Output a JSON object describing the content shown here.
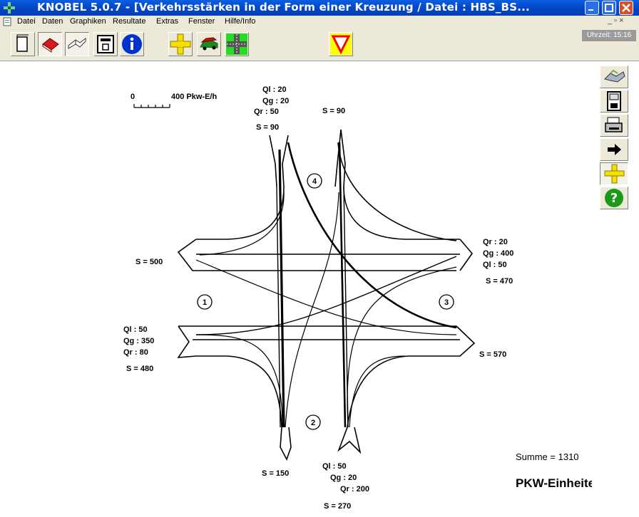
{
  "window": {
    "title": "KNOBEL 5.0.7 - [Verkehrsstärken in der Form einer Kreuzung / Datei :  HBS_BS..."
  },
  "menu": {
    "items": [
      "Datei",
      "Daten",
      "Graphiken",
      "Resultate",
      "Extras",
      "Fenster",
      "Hilfe/Info"
    ],
    "mdi_controls": "_ ▫ ×"
  },
  "status": {
    "clock": "Uhrzeit: 15:16"
  },
  "toolbar": {
    "icons": [
      "new-document-icon",
      "book-icon",
      "open-book-icon",
      "calculator-icon",
      "info-icon",
      "crossroad-icon",
      "cars-icon",
      "green-cross-icon",
      "yield-sign-icon"
    ]
  },
  "sidebar": {
    "icons": [
      "handshake-icon",
      "floppy-disk-icon",
      "printer-icon",
      "arrow-right-icon",
      "ruler-cross-icon",
      "help-icon"
    ]
  },
  "scale": {
    "zero": "0",
    "text": "400 Pkw-E/h"
  },
  "arms": {
    "north": {
      "number": "4",
      "ql": "Ql  : 20",
      "qg": "Qg : 20",
      "qr": "Qr : 50",
      "s_in": "S =  90",
      "s_out": "S =  90"
    },
    "west": {
      "number": "1",
      "ql": "Ql : 50",
      "qg": "Qg : 350",
      "qr": "Qr : 80",
      "s_in": "S =  480",
      "s_out": "S =  500"
    },
    "east": {
      "number": "3",
      "qr": "Qr : 20",
      "qg": "Qg : 400",
      "ql": "Ql  : 50",
      "s_in": "S =  470",
      "s_out": "S =  570"
    },
    "south": {
      "number": "2",
      "ql": "Ql : 50",
      "qg": "Qg : 20",
      "qr": "Qr : 200",
      "s_in": "S =  270",
      "s_out": "S =  150"
    }
  },
  "summary": {
    "total": "Summe =  1310",
    "unit": "PKW-Einheiten"
  },
  "colors": {
    "title_bar": "#0546c8",
    "chrome": "#ece9d8",
    "yield_fill": "#ffff00",
    "yield_stroke": "#ff0000"
  }
}
